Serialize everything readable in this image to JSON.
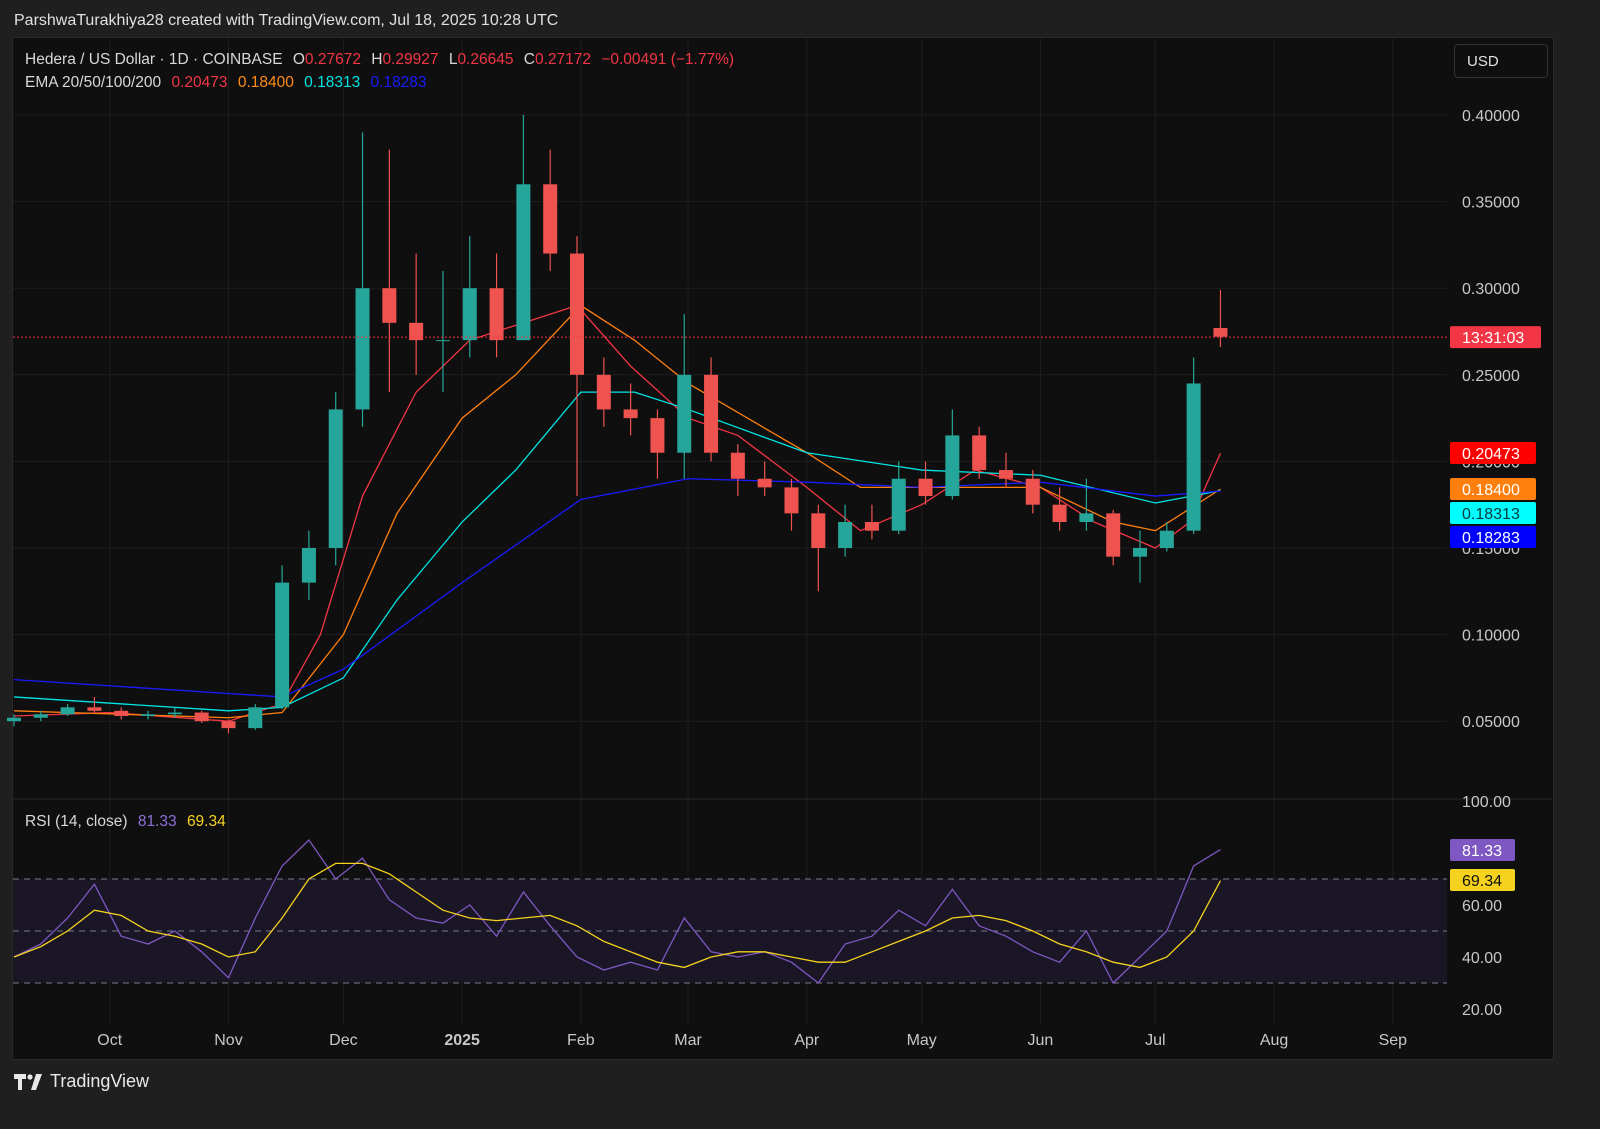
{
  "credit": "ParshwaTurakhiya28 created with TradingView.com, Jul 18, 2025 10:28 UTC",
  "footer_logo": "TradingView",
  "currency_button": "USD",
  "legend": {
    "symbol": "Hedera / US Dollar · 1D · COINBASE",
    "o_label": "O",
    "o": "0.27672",
    "h_label": "H",
    "h": "0.29927",
    "l_label": "L",
    "l": "0.26645",
    "c_label": "C",
    "c": "0.27172",
    "change": "−0.00491 (−1.77%)",
    "ema_label": "EMA 20/50/100/200",
    "ema20": "0.20473",
    "ema50": "0.18400",
    "ema100": "0.18313",
    "ema200": "0.18283",
    "rsi_label": "RSI (14, close)",
    "rsi": "81.33",
    "rsi_ma": "69.34"
  },
  "colors": {
    "up": "#26a69a",
    "down": "#ef5350",
    "ema20": "#f23645",
    "ema50": "#ff7f0e",
    "ema100": "#00e5e5",
    "ema200": "#1a1aff",
    "rsi": "#7e57c2",
    "rsi_ma": "#f5d21d",
    "countdown": "#f23645"
  },
  "countdown": "13:31:03",
  "chart_data": [
    {
      "type": "candlestick",
      "interval": "1D (approximated weekly)",
      "ylim": [
        0.0,
        0.42
      ],
      "grid": true,
      "y_ticks": [
        "0.40000",
        "0.35000",
        "0.30000",
        "0.25000",
        "0.20000",
        "0.15000",
        "0.10000",
        "0.05000"
      ],
      "x_ticks": [
        {
          "date": "2024-10-01",
          "label": "Oct"
        },
        {
          "date": "2024-11-01",
          "label": "Nov"
        },
        {
          "date": "2024-12-01",
          "label": "Dec"
        },
        {
          "date": "2025-01-01",
          "label": "2025"
        },
        {
          "date": "2025-02-01",
          "label": "Feb"
        },
        {
          "date": "2025-03-01",
          "label": "Mar"
        },
        {
          "date": "2025-04-01",
          "label": "Apr"
        },
        {
          "date": "2025-05-01",
          "label": "May"
        },
        {
          "date": "2025-06-01",
          "label": "Jun"
        },
        {
          "date": "2025-07-01",
          "label": "Jul"
        },
        {
          "date": "2025-08-01",
          "label": "Aug"
        },
        {
          "date": "2025-09-01",
          "label": "Sep"
        }
      ],
      "last_price": 0.27172,
      "ohlc": [
        [
          "2024-09-06",
          0.05,
          0.054,
          0.047,
          0.052
        ],
        [
          "2024-09-13",
          0.052,
          0.056,
          0.05,
          0.054
        ],
        [
          "2024-09-20",
          0.054,
          0.06,
          0.053,
          0.058
        ],
        [
          "2024-09-27",
          0.058,
          0.064,
          0.055,
          0.056
        ],
        [
          "2024-10-04",
          0.056,
          0.058,
          0.051,
          0.053
        ],
        [
          "2024-10-11",
          0.053,
          0.056,
          0.051,
          0.054
        ],
        [
          "2024-10-18",
          0.054,
          0.058,
          0.052,
          0.055
        ],
        [
          "2024-10-25",
          0.055,
          0.056,
          0.049,
          0.05
        ],
        [
          "2024-11-01",
          0.05,
          0.051,
          0.043,
          0.046
        ],
        [
          "2024-11-08",
          0.046,
          0.06,
          0.045,
          0.058
        ],
        [
          "2024-11-15",
          0.058,
          0.14,
          0.057,
          0.13
        ],
        [
          "2024-11-22",
          0.13,
          0.16,
          0.12,
          0.15
        ],
        [
          "2024-11-29",
          0.15,
          0.24,
          0.14,
          0.23
        ],
        [
          "2024-12-06",
          0.23,
          0.39,
          0.22,
          0.3
        ],
        [
          "2024-12-13",
          0.3,
          0.38,
          0.24,
          0.28
        ],
        [
          "2024-12-20",
          0.28,
          0.32,
          0.25,
          0.27
        ],
        [
          "2024-12-27",
          0.27,
          0.31,
          0.24,
          0.27
        ],
        [
          "2025-01-03",
          0.27,
          0.33,
          0.26,
          0.3
        ],
        [
          "2025-01-10",
          0.3,
          0.32,
          0.26,
          0.27
        ],
        [
          "2025-01-17",
          0.27,
          0.4,
          0.27,
          0.36
        ],
        [
          "2025-01-24",
          0.36,
          0.38,
          0.31,
          0.32
        ],
        [
          "2025-01-31",
          0.32,
          0.33,
          0.18,
          0.25
        ],
        [
          "2025-02-07",
          0.25,
          0.26,
          0.22,
          0.23
        ],
        [
          "2025-02-14",
          0.23,
          0.245,
          0.215,
          0.225
        ],
        [
          "2025-02-21",
          0.225,
          0.23,
          0.19,
          0.205
        ],
        [
          "2025-02-28",
          0.205,
          0.285,
          0.19,
          0.25
        ],
        [
          "2025-03-07",
          0.25,
          0.26,
          0.2,
          0.205
        ],
        [
          "2025-03-14",
          0.205,
          0.21,
          0.18,
          0.19
        ],
        [
          "2025-03-21",
          0.19,
          0.2,
          0.18,
          0.185
        ],
        [
          "2025-03-28",
          0.185,
          0.19,
          0.16,
          0.17
        ],
        [
          "2025-04-04",
          0.17,
          0.175,
          0.125,
          0.15
        ],
        [
          "2025-04-11",
          0.15,
          0.175,
          0.145,
          0.165
        ],
        [
          "2025-04-18",
          0.165,
          0.175,
          0.155,
          0.16
        ],
        [
          "2025-04-25",
          0.16,
          0.2,
          0.158,
          0.19
        ],
        [
          "2025-05-02",
          0.19,
          0.2,
          0.175,
          0.18
        ],
        [
          "2025-05-09",
          0.18,
          0.23,
          0.178,
          0.215
        ],
        [
          "2025-05-16",
          0.215,
          0.22,
          0.19,
          0.195
        ],
        [
          "2025-05-23",
          0.195,
          0.205,
          0.185,
          0.19
        ],
        [
          "2025-05-30",
          0.19,
          0.195,
          0.17,
          0.175
        ],
        [
          "2025-06-06",
          0.175,
          0.185,
          0.16,
          0.165
        ],
        [
          "2025-06-13",
          0.165,
          0.19,
          0.16,
          0.17
        ],
        [
          "2025-06-20",
          0.17,
          0.172,
          0.14,
          0.145
        ],
        [
          "2025-06-27",
          0.145,
          0.16,
          0.13,
          0.15
        ],
        [
          "2025-07-04",
          0.15,
          0.165,
          0.148,
          0.16
        ],
        [
          "2025-07-11",
          0.16,
          0.26,
          0.158,
          0.245
        ],
        [
          "2025-07-18",
          0.277,
          0.299,
          0.266,
          0.272
        ]
      ],
      "ema": [
        {
          "name": "EMA 20",
          "key": "ema20",
          "points": [
            [
              "2024-09-06",
              0.053
            ],
            [
              "2024-10-01",
              0.055
            ],
            [
              "2024-11-01",
              0.05
            ],
            [
              "2024-11-15",
              0.06
            ],
            [
              "2024-11-25",
              0.1
            ],
            [
              "2024-12-06",
              0.18
            ],
            [
              "2024-12-20",
              0.24
            ],
            [
              "2025-01-03",
              0.27
            ],
            [
              "2025-01-17",
              0.28
            ],
            [
              "2025-01-31",
              0.29
            ],
            [
              "2025-02-14",
              0.255
            ],
            [
              "2025-03-01",
              0.225
            ],
            [
              "2025-03-14",
              0.215
            ],
            [
              "2025-04-01",
              0.185
            ],
            [
              "2025-04-15",
              0.16
            ],
            [
              "2025-05-01",
              0.175
            ],
            [
              "2025-05-15",
              0.195
            ],
            [
              "2025-06-01",
              0.185
            ],
            [
              "2025-06-15",
              0.165
            ],
            [
              "2025-07-01",
              0.15
            ],
            [
              "2025-07-10",
              0.165
            ],
            [
              "2025-07-18",
              0.20473
            ]
          ]
        },
        {
          "name": "EMA 50",
          "key": "ema50",
          "points": [
            [
              "2024-09-06",
              0.056
            ],
            [
              "2024-11-01",
              0.052
            ],
            [
              "2024-11-15",
              0.055
            ],
            [
              "2024-12-01",
              0.1
            ],
            [
              "2024-12-15",
              0.17
            ],
            [
              "2025-01-01",
              0.225
            ],
            [
              "2025-01-15",
              0.25
            ],
            [
              "2025-02-01",
              0.29
            ],
            [
              "2025-02-15",
              0.27
            ],
            [
              "2025-03-01",
              0.245
            ],
            [
              "2025-04-01",
              0.205
            ],
            [
              "2025-04-15",
              0.185
            ],
            [
              "2025-05-01",
              0.185
            ],
            [
              "2025-06-01",
              0.185
            ],
            [
              "2025-06-20",
              0.165
            ],
            [
              "2025-07-01",
              0.16
            ],
            [
              "2025-07-18",
              0.184
            ]
          ]
        },
        {
          "name": "EMA 100",
          "key": "ema100",
          "points": [
            [
              "2024-09-06",
              0.064
            ],
            [
              "2024-11-01",
              0.056
            ],
            [
              "2024-11-15",
              0.058
            ],
            [
              "2024-12-01",
              0.075
            ],
            [
              "2024-12-15",
              0.12
            ],
            [
              "2025-01-01",
              0.165
            ],
            [
              "2025-01-15",
              0.195
            ],
            [
              "2025-02-01",
              0.24
            ],
            [
              "2025-02-15",
              0.24
            ],
            [
              "2025-03-01",
              0.23
            ],
            [
              "2025-04-01",
              0.205
            ],
            [
              "2025-05-01",
              0.195
            ],
            [
              "2025-06-01",
              0.192
            ],
            [
              "2025-07-01",
              0.176
            ],
            [
              "2025-07-18",
              0.18313
            ]
          ]
        },
        {
          "name": "EMA 200",
          "key": "ema200",
          "points": [
            [
              "2024-09-06",
              0.074
            ],
            [
              "2024-11-01",
              0.066
            ],
            [
              "2024-11-15",
              0.064
            ],
            [
              "2024-12-01",
              0.08
            ],
            [
              "2025-01-01",
              0.13
            ],
            [
              "2025-02-01",
              0.178
            ],
            [
              "2025-03-01",
              0.19
            ],
            [
              "2025-04-01",
              0.188
            ],
            [
              "2025-05-01",
              0.185
            ],
            [
              "2025-06-01",
              0.188
            ],
            [
              "2025-07-01",
              0.18
            ],
            [
              "2025-07-18",
              0.18283
            ]
          ]
        }
      ]
    },
    {
      "type": "line",
      "title": "RSI (14, close)",
      "ylim": [
        15,
        100
      ],
      "y_ticks": [
        "100.00",
        "60.00",
        "40.00",
        "20.00"
      ],
      "bands": [
        70,
        50,
        30
      ],
      "dates": [
        "2024-09-06",
        "2024-09-13",
        "2024-09-20",
        "2024-09-27",
        "2024-10-04",
        "2024-10-11",
        "2024-10-18",
        "2024-10-25",
        "2024-11-01",
        "2024-11-08",
        "2024-11-15",
        "2024-11-22",
        "2024-11-29",
        "2024-12-06",
        "2024-12-13",
        "2024-12-20",
        "2024-12-27",
        "2025-01-03",
        "2025-01-10",
        "2025-01-17",
        "2025-01-24",
        "2025-01-31",
        "2025-02-07",
        "2025-02-14",
        "2025-02-21",
        "2025-02-28",
        "2025-03-07",
        "2025-03-14",
        "2025-03-21",
        "2025-03-28",
        "2025-04-04",
        "2025-04-11",
        "2025-04-18",
        "2025-04-25",
        "2025-05-02",
        "2025-05-09",
        "2025-05-16",
        "2025-05-23",
        "2025-05-30",
        "2025-06-06",
        "2025-06-13",
        "2025-06-20",
        "2025-06-27",
        "2025-07-04",
        "2025-07-11",
        "2025-07-18"
      ],
      "series": [
        {
          "key": "rsi",
          "values": [
            40,
            45,
            55,
            68,
            48,
            45,
            50,
            42,
            32,
            55,
            75,
            85,
            70,
            78,
            62,
            55,
            53,
            60,
            48,
            65,
            52,
            40,
            35,
            38,
            35,
            55,
            42,
            40,
            42,
            38,
            30,
            45,
            48,
            58,
            52,
            66,
            52,
            48,
            42,
            38,
            50,
            30,
            40,
            50,
            75,
            81.33
          ]
        },
        {
          "key": "rsi_ma",
          "values": [
            40,
            44,
            50,
            58,
            56,
            50,
            48,
            45,
            40,
            42,
            55,
            70,
            76,
            76,
            72,
            65,
            58,
            55,
            54,
            55,
            56,
            52,
            46,
            42,
            38,
            36,
            40,
            42,
            42,
            40,
            38,
            38,
            42,
            46,
            50,
            55,
            56,
            54,
            50,
            45,
            42,
            38,
            36,
            40,
            50,
            69.34
          ]
        }
      ]
    }
  ]
}
